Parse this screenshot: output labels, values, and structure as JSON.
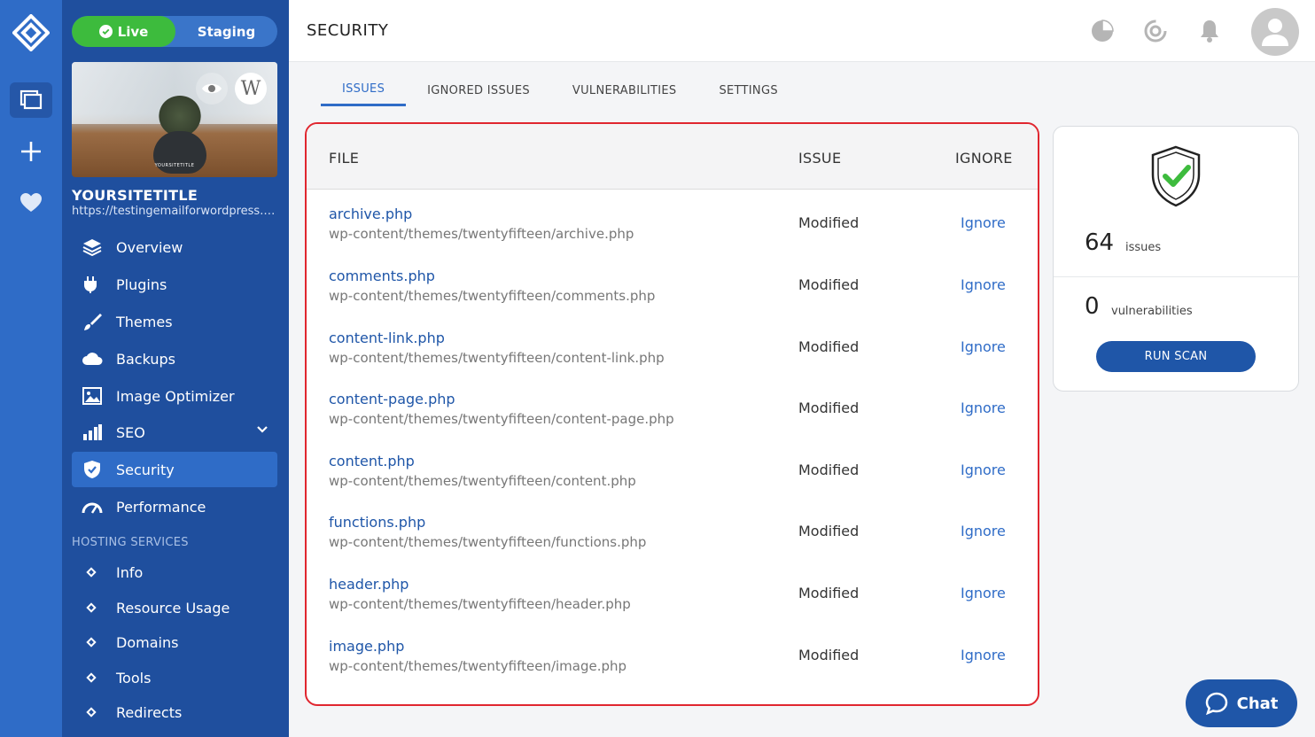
{
  "env": {
    "live_label": "Live",
    "staging_label": "Staging"
  },
  "site": {
    "thumb_caption": "YOURSITETITLE",
    "title": "YOURSITETITLE",
    "url": "https://testingemailforwordpress.com"
  },
  "nav": {
    "items": [
      {
        "label": "Overview",
        "icon": "layers-icon"
      },
      {
        "label": "Plugins",
        "icon": "plug-icon"
      },
      {
        "label": "Themes",
        "icon": "brush-icon"
      },
      {
        "label": "Backups",
        "icon": "cloud-icon"
      },
      {
        "label": "Image Optimizer",
        "icon": "image-icon"
      },
      {
        "label": "SEO",
        "icon": "bar-chart-icon"
      },
      {
        "label": "Security",
        "icon": "shield-icon",
        "active": true
      },
      {
        "label": "Performance",
        "icon": "gauge-icon"
      }
    ],
    "section_label": "HOSTING SERVICES",
    "sub_items": [
      "Info",
      "Resource Usage",
      "Domains",
      "Tools",
      "Redirects"
    ]
  },
  "header": {
    "title": "SECURITY"
  },
  "tabs": [
    {
      "label": "ISSUES",
      "active": true
    },
    {
      "label": "IGNORED ISSUES"
    },
    {
      "label": "VULNERABILITIES"
    },
    {
      "label": "SETTINGS"
    }
  ],
  "table": {
    "columns": {
      "file": "FILE",
      "issue": "ISSUE",
      "ignore": "IGNORE"
    },
    "rows": [
      {
        "name": "archive.php",
        "path": "wp-content/themes/twentyfifteen/archive.php",
        "issue": "Modified",
        "action": "Ignore"
      },
      {
        "name": "comments.php",
        "path": "wp-content/themes/twentyfifteen/comments.php",
        "issue": "Modified",
        "action": "Ignore"
      },
      {
        "name": "content-link.php",
        "path": "wp-content/themes/twentyfifteen/content-link.php",
        "issue": "Modified",
        "action": "Ignore"
      },
      {
        "name": "content-page.php",
        "path": "wp-content/themes/twentyfifteen/content-page.php",
        "issue": "Modified",
        "action": "Ignore"
      },
      {
        "name": "content.php",
        "path": "wp-content/themes/twentyfifteen/content.php",
        "issue": "Modified",
        "action": "Ignore"
      },
      {
        "name": "functions.php",
        "path": "wp-content/themes/twentyfifteen/functions.php",
        "issue": "Modified",
        "action": "Ignore"
      },
      {
        "name": "header.php",
        "path": "wp-content/themes/twentyfifteen/header.php",
        "issue": "Modified",
        "action": "Ignore"
      },
      {
        "name": "image.php",
        "path": "wp-content/themes/twentyfifteen/image.php",
        "issue": "Modified",
        "action": "Ignore"
      }
    ]
  },
  "summary": {
    "issues_count": "64",
    "issues_label": "issues",
    "vuln_count": "0",
    "vuln_label": "vulnerabilities",
    "scan_label": "RUN SCAN"
  },
  "chat": {
    "label": "Chat"
  },
  "colors": {
    "rail": "#2f6cc7",
    "sidebar": "#1f4f9e",
    "accent": "#2f6cc7",
    "live": "#3dbb3d",
    "highlight": "#e0262f",
    "shield_check": "#3dbb3d"
  }
}
